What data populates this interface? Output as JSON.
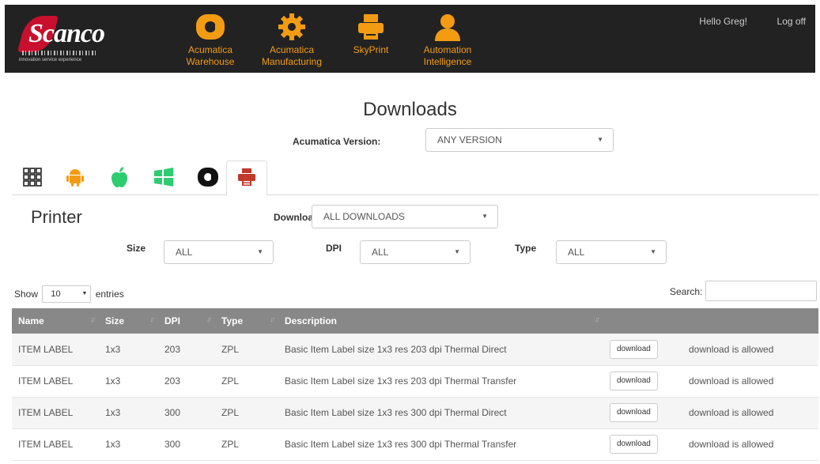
{
  "header": {
    "logo": {
      "word": "Scanco",
      "tagline": "innovation service experience"
    },
    "nav": [
      {
        "label_line1": "Acumatica",
        "label_line2": "Warehouse",
        "icon": "acumatica-a-icon"
      },
      {
        "label_line1": "Acumatica",
        "label_line2": "Manufacturing",
        "icon": "gear-icon"
      },
      {
        "label_line1": "SkyPrint",
        "label_line2": "",
        "icon": "printer-icon"
      },
      {
        "label_line1": "Automation",
        "label_line2": "Intelligence",
        "icon": "person-icon"
      }
    ],
    "greeting": "Hello Greg!",
    "logoff": "Log off",
    "accent_color": "#f39c12"
  },
  "page": {
    "title": "Downloads",
    "version_label": "Acumatica Version:",
    "version_value": "ANY VERSION"
  },
  "tabs": [
    {
      "icon": "grid-icon"
    },
    {
      "icon": "android-icon"
    },
    {
      "icon": "apple-icon"
    },
    {
      "icon": "windows-icon"
    },
    {
      "icon": "acumatica-icon"
    },
    {
      "icon": "printer-icon",
      "active": true
    }
  ],
  "section": {
    "title": "Printer",
    "download_label": "Download:",
    "download_value": "ALL DOWNLOADS",
    "size_label": "Size",
    "size_value": "ALL",
    "dpi_label": "DPI",
    "dpi_value": "ALL",
    "type_label": "Type",
    "type_value": "ALL"
  },
  "table_controls": {
    "show_label": "Show",
    "entries_value": "10",
    "entries_label": "entries",
    "search_label": "Search:"
  },
  "table": {
    "columns": [
      "Name",
      "Size",
      "DPI",
      "Type",
      "Description"
    ],
    "rows": [
      {
        "name": "ITEM LABEL",
        "size": "1x3",
        "dpi": "203",
        "type": "ZPL",
        "description": "Basic Item Label size 1x3 res 203 dpi Thermal Direct",
        "button": "download",
        "status": "download is allowed"
      },
      {
        "name": "ITEM LABEL",
        "size": "1x3",
        "dpi": "203",
        "type": "ZPL",
        "description": "Basic Item Label size 1x3 res 203 dpi Thermal Transfer",
        "button": "download",
        "status": "download is allowed"
      },
      {
        "name": "ITEM LABEL",
        "size": "1x3",
        "dpi": "300",
        "type": "ZPL",
        "description": "Basic Item Label size 1x3 res 300 dpi Thermal Direct",
        "button": "download",
        "status": "download is allowed"
      },
      {
        "name": "ITEM LABEL",
        "size": "1x3",
        "dpi": "300",
        "type": "ZPL",
        "description": "Basic Item Label size 1x3 res 300 dpi Thermal Transfer",
        "button": "download",
        "status": "download is allowed"
      }
    ]
  }
}
